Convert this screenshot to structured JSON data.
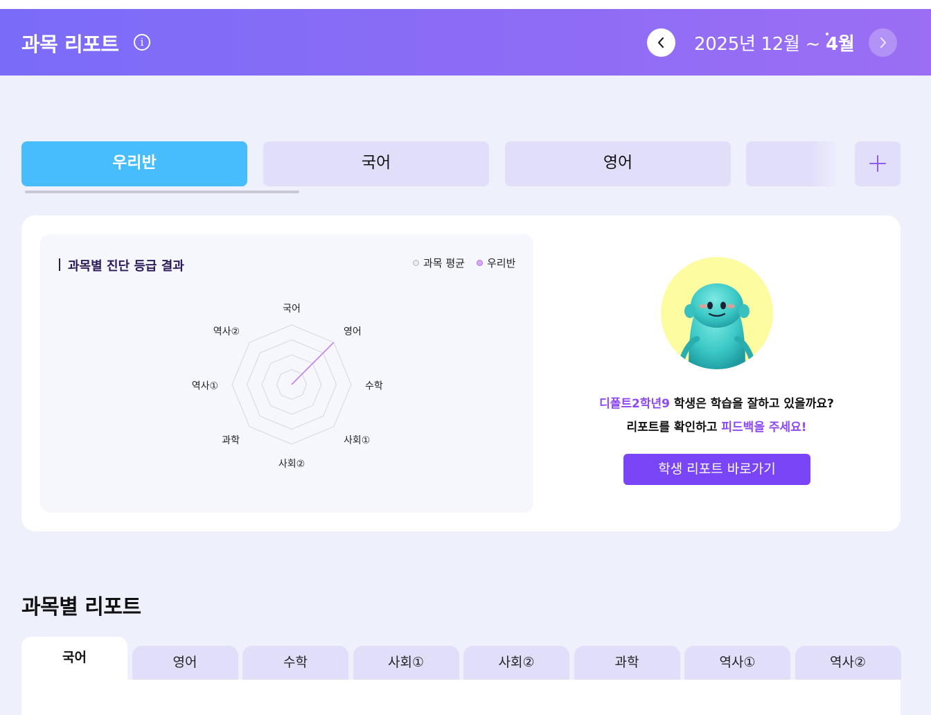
{
  "header": {
    "title": "과목 리포트",
    "info_icon": "info-icon",
    "date_prefix": "2025년 12월 ~ ",
    "date_end": "4월",
    "prev_icon": "chevron-left-icon",
    "next_icon": "chevron-right-icon"
  },
  "class_tabs": {
    "items": [
      {
        "label": "우리반",
        "active": true
      },
      {
        "label": "국어",
        "active": false
      },
      {
        "label": "영어",
        "active": false
      },
      {
        "label": "",
        "active": false
      }
    ],
    "add_icon": "plus-icon"
  },
  "chart_panel": {
    "title": "과목별 진단 등급 결과",
    "legend": [
      {
        "label": "과목 평균",
        "color": "#e4e4ea"
      },
      {
        "label": "우리반",
        "color": "#d7a1f5"
      }
    ]
  },
  "chart_data": {
    "type": "radar",
    "title": "과목별 진단 등급 결과",
    "axes": [
      "국어",
      "영어",
      "수학",
      "사회①",
      "사회②",
      "과학",
      "역사①",
      "역사②"
    ],
    "rings": 4,
    "range": [
      0,
      4
    ],
    "series": [
      {
        "name": "우리반",
        "color": "#c77df0",
        "values": [
          0,
          4,
          0,
          0,
          0,
          0,
          0,
          0
        ]
      },
      {
        "name": "과목 평균",
        "color": "#d4d4dc",
        "values": [
          0,
          0,
          0,
          0,
          0,
          0,
          0,
          0
        ]
      }
    ],
    "legend": "top-right",
    "grid": true
  },
  "student_card": {
    "avatar_icon": "mascot-avatar",
    "student_name": "디폴트2학년9",
    "line1_rest": " 학생은 학습을 잘하고 있을까요?",
    "line2_prefix": "리포트를 확인하고 ",
    "line2_highlight": "피드백을 주세요!",
    "button_label": "학생 리포트 바로가기"
  },
  "subject_section": {
    "title": "과목별 리포트",
    "tabs": [
      {
        "label": "국어",
        "active": true
      },
      {
        "label": "영어",
        "active": false
      },
      {
        "label": "수학",
        "active": false
      },
      {
        "label": "사회①",
        "active": false
      },
      {
        "label": "사회②",
        "active": false
      },
      {
        "label": "과학",
        "active": false
      },
      {
        "label": "역사①",
        "active": false
      },
      {
        "label": "역사②",
        "active": false
      }
    ]
  }
}
